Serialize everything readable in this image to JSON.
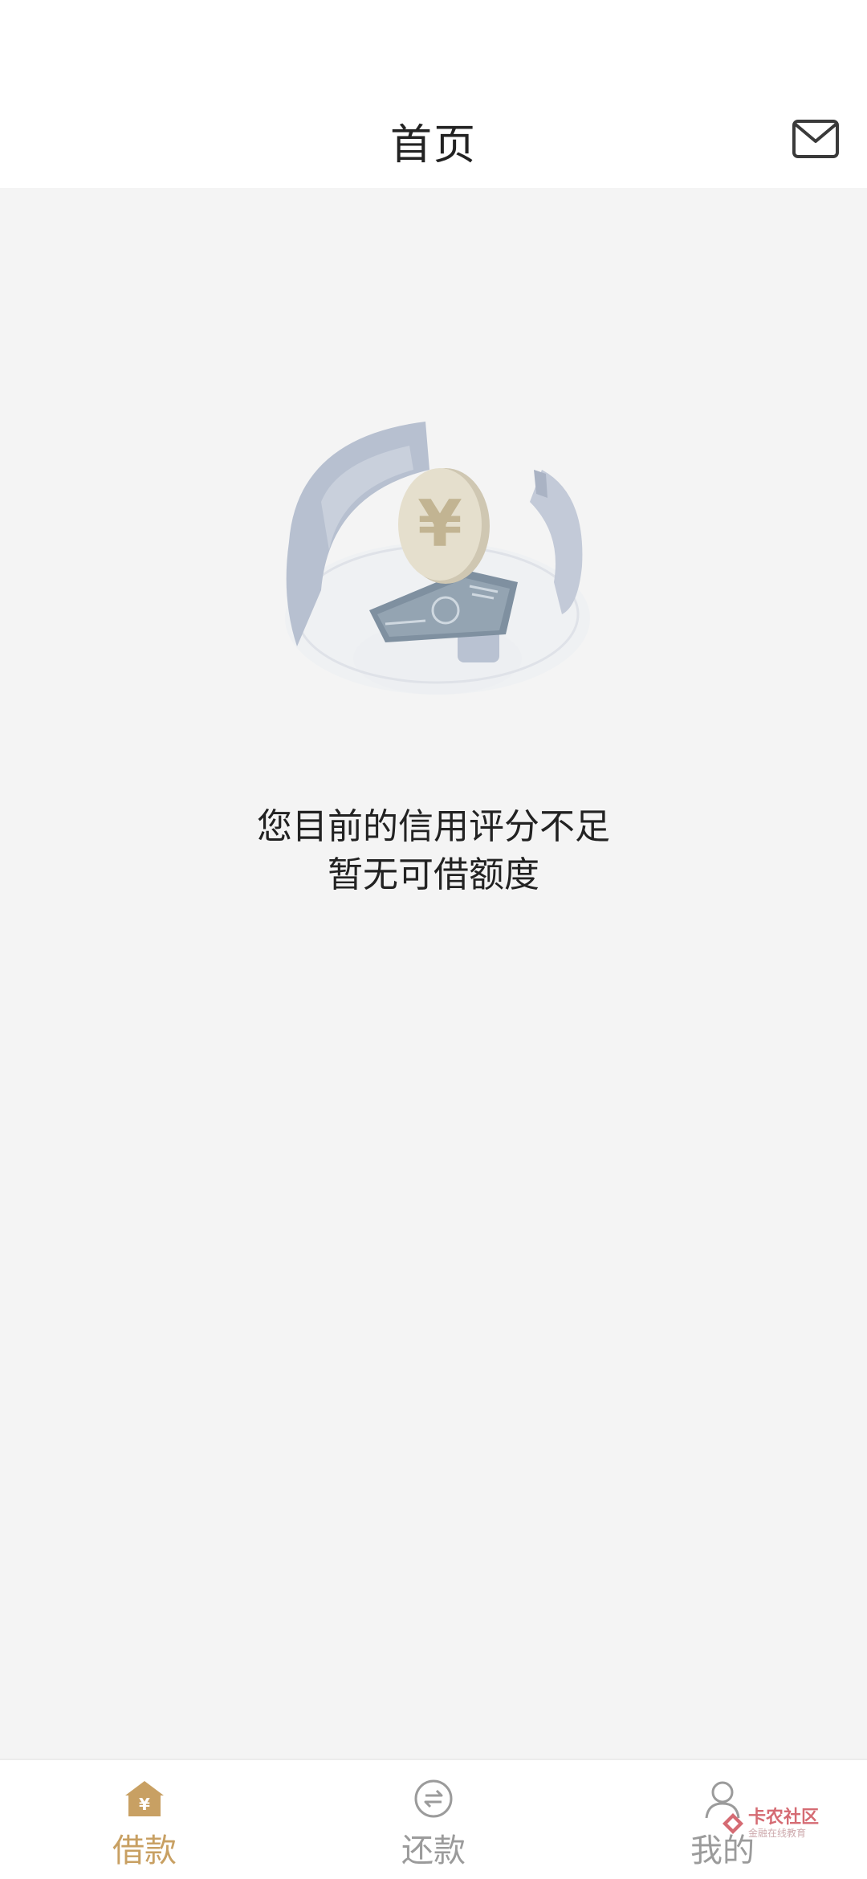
{
  "header": {
    "title": "首页",
    "mail_icon": "mail-icon"
  },
  "empty_state": {
    "illustration_icon": "yuan-coin-illustration",
    "line1": "您目前的信用评分不足",
    "line2": "暂无可借额度"
  },
  "tab_bar": {
    "tabs": [
      {
        "label": "借款",
        "icon": "home-yuan-icon",
        "active": true
      },
      {
        "label": "还款",
        "icon": "exchange-circle-icon",
        "active": false
      },
      {
        "label": "我的",
        "icon": "person-icon",
        "active": false
      }
    ]
  },
  "watermark": {
    "title": "卡农社区",
    "subtitle": "金融在线教育"
  },
  "colors": {
    "accent": "#c8a063",
    "inactive": "#9b9b9b",
    "background": "#f4f4f4"
  }
}
